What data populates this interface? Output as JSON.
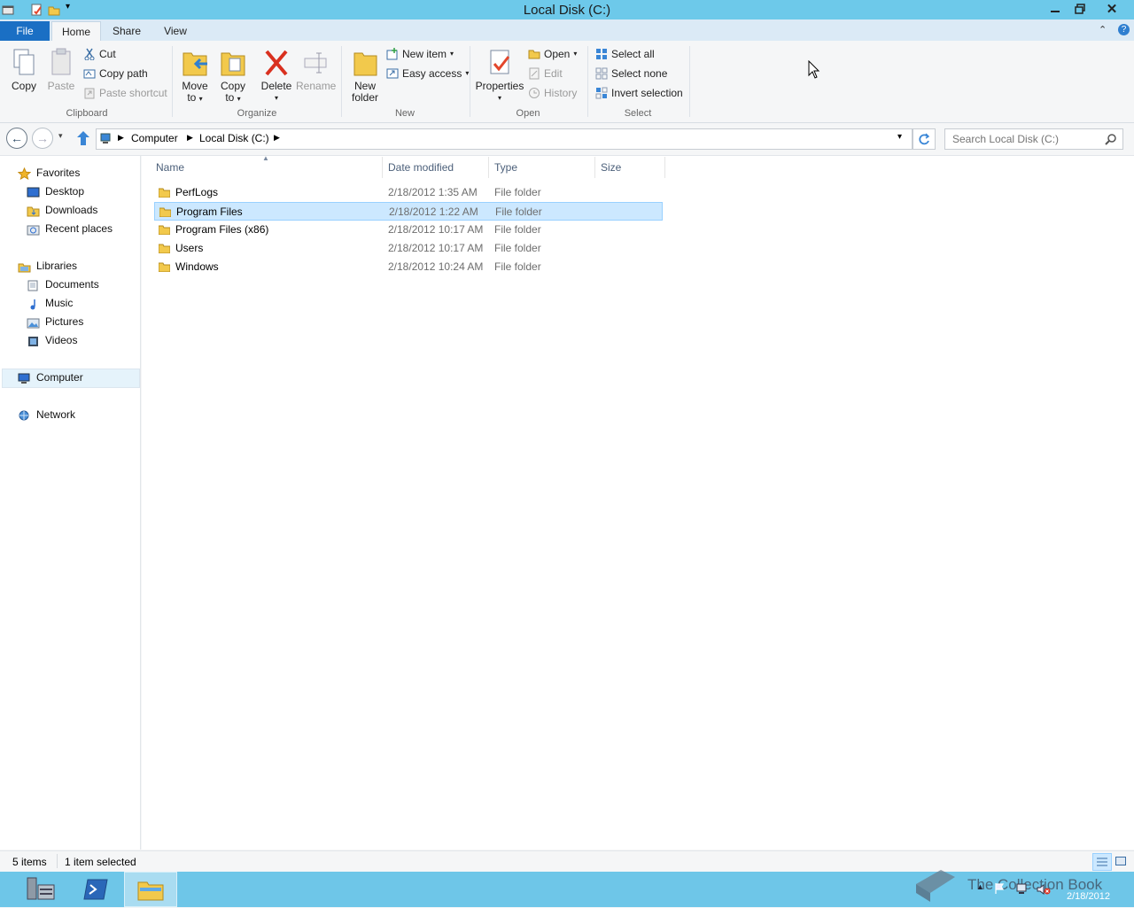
{
  "window": {
    "title": "Local Disk (C:)"
  },
  "ribbon": {
    "tabs": {
      "file": "File",
      "home": "Home",
      "share": "Share",
      "view": "View"
    },
    "clipboard": {
      "group": "Clipboard",
      "copy": "Copy",
      "paste": "Paste",
      "cut": "Cut",
      "copy_path": "Copy path",
      "paste_shortcut": "Paste shortcut"
    },
    "organize": {
      "group": "Organize",
      "move_to_1": "Move",
      "move_to_2": "to",
      "copy_to_1": "Copy",
      "copy_to_2": "to",
      "delete": "Delete",
      "rename": "Rename"
    },
    "new": {
      "group": "New",
      "new_folder_1": "New",
      "new_folder_2": "folder",
      "new_item": "New item",
      "easy_access": "Easy access"
    },
    "open": {
      "group": "Open",
      "properties": "Properties",
      "open": "Open",
      "edit": "Edit",
      "history": "History"
    },
    "select": {
      "group": "Select",
      "select_all": "Select all",
      "select_none": "Select none",
      "invert_selection": "Invert selection"
    }
  },
  "address": {
    "crumbs": [
      "Computer",
      "Local Disk (C:)"
    ],
    "search_placeholder": "Search Local Disk (C:)"
  },
  "navpane": {
    "favorites": "Favorites",
    "desktop": "Desktop",
    "downloads": "Downloads",
    "recent": "Recent places",
    "libraries": "Libraries",
    "documents": "Documents",
    "music": "Music",
    "pictures": "Pictures",
    "videos": "Videos",
    "computer": "Computer",
    "network": "Network"
  },
  "columns": {
    "name": "Name",
    "date": "Date modified",
    "type": "Type",
    "size": "Size"
  },
  "files": [
    {
      "name": "PerfLogs",
      "date": "2/18/2012 1:35 AM",
      "type": "File folder"
    },
    {
      "name": "Program Files",
      "date": "2/18/2012 1:22 AM",
      "type": "File folder"
    },
    {
      "name": "Program Files (x86)",
      "date": "2/18/2012 10:17 AM",
      "type": "File folder"
    },
    {
      "name": "Users",
      "date": "2/18/2012 10:17 AM",
      "type": "File folder"
    },
    {
      "name": "Windows",
      "date": "2/18/2012 10:24 AM",
      "type": "File folder"
    }
  ],
  "status": {
    "count": "5 items",
    "selected": "1 item selected"
  },
  "taskbar": {
    "date": "2/18/2012"
  },
  "watermark": "The Collection Book",
  "colors": {
    "accent": "#1a6fc4",
    "titlebar": "#6dc9ea",
    "selection": "#cce8ff",
    "taskbar": "#6ec6e8"
  }
}
